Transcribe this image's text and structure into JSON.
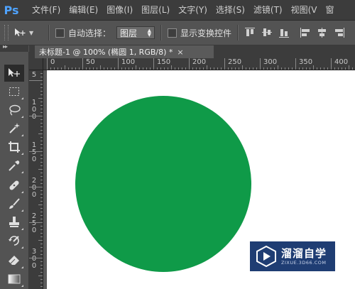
{
  "app": {
    "logo": "Ps"
  },
  "menu": [
    "文件(F)",
    "编辑(E)",
    "图像(I)",
    "图层(L)",
    "文字(Y)",
    "选择(S)",
    "滤镜(T)",
    "视图(V",
    "窗"
  ],
  "options": {
    "tool_icon": "move-tool-icon",
    "auto_select_label": "自动选择：",
    "auto_select_checked": false,
    "layer_dropdown_value": "图层",
    "show_transform_label": "显示变换控件",
    "show_transform_checked": false,
    "align_icons": [
      "align-top-icon",
      "align-vcenter-icon",
      "align-bottom-icon",
      "align-left-icon",
      "align-hcenter-icon",
      "align-right-icon"
    ]
  },
  "tools": [
    {
      "name": "move-tool-icon",
      "active": true
    },
    {
      "name": "marquee-tool-icon"
    },
    {
      "name": "lasso-tool-icon"
    },
    {
      "name": "magic-wand-tool-icon"
    },
    {
      "name": "crop-tool-icon"
    },
    {
      "name": "eyedropper-tool-icon"
    },
    {
      "name": "healing-brush-tool-icon"
    },
    {
      "name": "brush-tool-icon"
    },
    {
      "name": "clone-stamp-tool-icon"
    },
    {
      "name": "history-brush-tool-icon"
    },
    {
      "name": "eraser-tool-icon"
    },
    {
      "name": "gradient-tool-icon"
    }
  ],
  "document": {
    "tab_title": "未标题-1 @ 100% (椭圆 1, RGB/8) *",
    "close_symbol": "×"
  },
  "ruler": {
    "horizontal_labels": [
      "0",
      "50",
      "100",
      "150",
      "200",
      "250",
      "300",
      "350",
      "400"
    ],
    "vertical_labels": [
      [
        "5"
      ],
      [
        "1",
        "0",
        "0"
      ],
      [
        "1",
        "5",
        "0"
      ],
      [
        "2",
        "0",
        "0"
      ],
      [
        "2",
        "5",
        "0"
      ],
      [
        "3",
        "0",
        "0"
      ]
    ]
  },
  "canvas": {
    "background": "#ffffff",
    "shape": {
      "type": "ellipse",
      "fill": "#0f9a48"
    }
  },
  "watermark": {
    "title": "溜溜自学",
    "subtitle": "ZIXUE.3D66.COM",
    "background": "#1f3d73"
  }
}
